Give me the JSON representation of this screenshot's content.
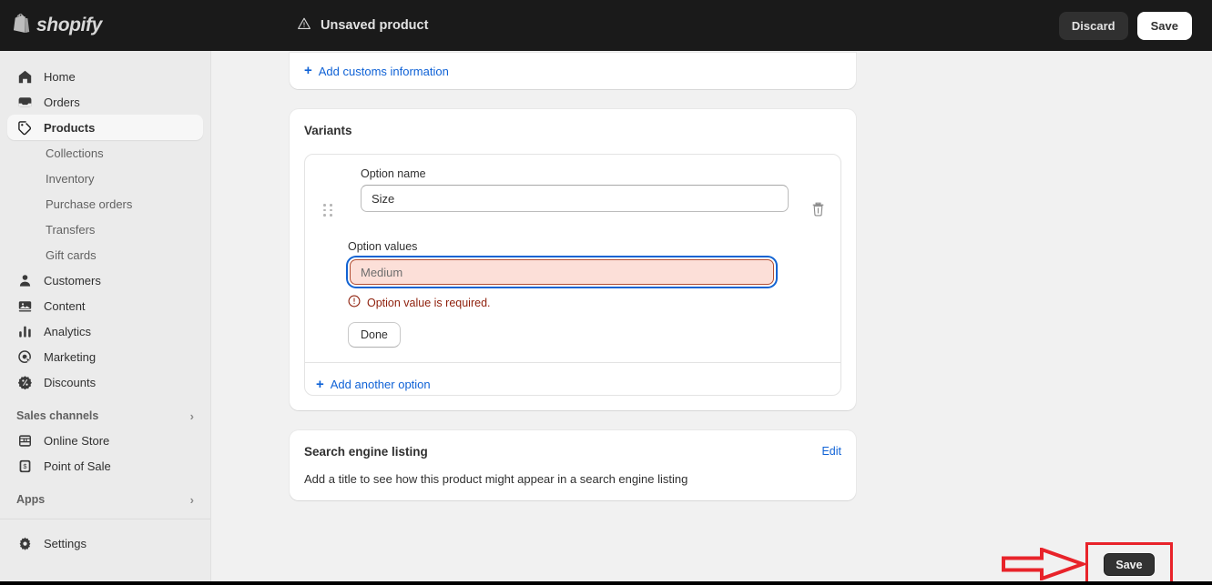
{
  "topbar": {
    "brand": "shopify",
    "brand_icon": "shopify-bag-icon",
    "status_icon": "warning-triangle-icon",
    "status_text": "Unsaved product",
    "discard_label": "Discard",
    "save_label": "Save"
  },
  "sidebar": {
    "items": [
      {
        "label": "Home",
        "icon": "home-icon",
        "name": "home",
        "active": false
      },
      {
        "label": "Orders",
        "icon": "orders-inbox-icon",
        "name": "orders",
        "active": false
      },
      {
        "label": "Products",
        "icon": "products-tag-icon",
        "name": "products",
        "active": true
      }
    ],
    "sub_items": [
      {
        "label": "Collections",
        "name": "collections"
      },
      {
        "label": "Inventory",
        "name": "inventory"
      },
      {
        "label": "Purchase orders",
        "name": "purchase-orders"
      },
      {
        "label": "Transfers",
        "name": "transfers"
      },
      {
        "label": "Gift cards",
        "name": "gift-cards"
      }
    ],
    "items2": [
      {
        "label": "Customers",
        "icon": "customer-person-icon",
        "name": "customers"
      },
      {
        "label": "Content",
        "icon": "content-image-icon",
        "name": "content"
      },
      {
        "label": "Analytics",
        "icon": "analytics-bars-icon",
        "name": "analytics"
      },
      {
        "label": "Marketing",
        "icon": "marketing-target-icon",
        "name": "marketing"
      },
      {
        "label": "Discounts",
        "icon": "discount-badge-icon",
        "name": "discounts"
      }
    ],
    "sales_channels": {
      "label": "Sales channels",
      "chevron": "›",
      "items": [
        {
          "label": "Online Store",
          "icon": "storefront-icon",
          "name": "online-store"
        },
        {
          "label": "Point of Sale",
          "icon": "pos-receipt-icon",
          "name": "point-of-sale"
        }
      ]
    },
    "apps": {
      "label": "Apps",
      "chevron": "›"
    },
    "settings": {
      "label": "Settings",
      "icon": "gear-icon"
    }
  },
  "main": {
    "customs_card": {
      "add_customs_label": "Add customs information",
      "plus": "+"
    },
    "variants_card": {
      "title": "Variants",
      "option_name_label": "Option name",
      "option_name_value": "Size",
      "option_values_label": "Option values",
      "option_values_placeholder": "Medium",
      "option_values_value": "",
      "error_icon": "error-circle-icon",
      "error_text": "Option value is required.",
      "done_label": "Done",
      "add_another_label": "Add another option",
      "plus": "+",
      "delete_icon": "trash-icon",
      "drag_icon": "drag-handle-icon"
    },
    "seo_card": {
      "title": "Search engine listing",
      "edit_label": "Edit",
      "body": "Add a title to see how this product might appear in a search engine listing"
    }
  },
  "annotations": {
    "arrow": {
      "icon": "red-arrow-right-icon",
      "color": "#e8232a"
    },
    "highlight_box": {
      "color": "#e8232a"
    },
    "save_button_label": "Save"
  }
}
